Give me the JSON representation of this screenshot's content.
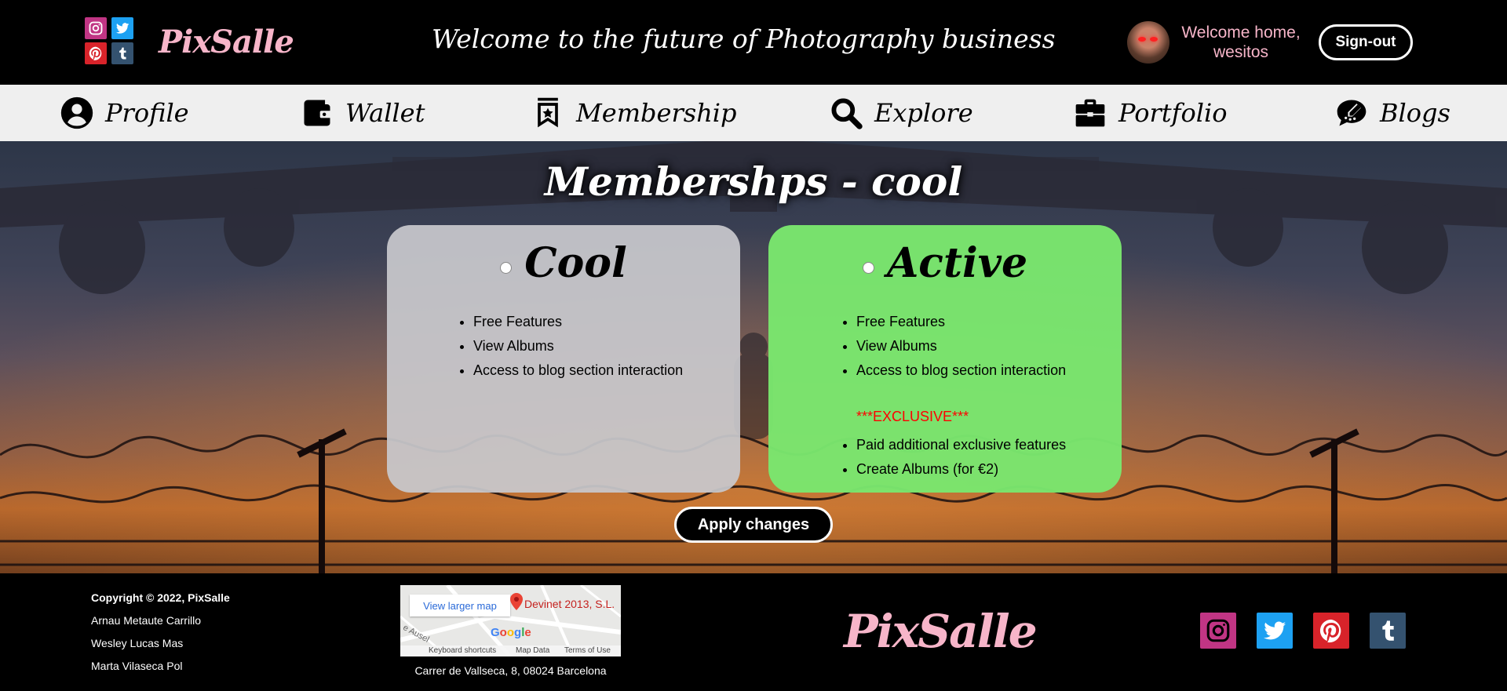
{
  "header": {
    "logo": "PixSalle",
    "tagline": "Welcome to the future of Photography business",
    "welcome": "Welcome home, wesitos",
    "signout_label": "Sign-out",
    "social": [
      "instagram-icon",
      "twitter-icon",
      "pinterest-icon",
      "tumblr-icon"
    ]
  },
  "nav": {
    "items": [
      {
        "label": "Profile",
        "icon": "user-circle-icon"
      },
      {
        "label": "Wallet",
        "icon": "wallet-icon"
      },
      {
        "label": "Membership",
        "icon": "bookmark-star-icon"
      },
      {
        "label": "Explore",
        "icon": "search-icon"
      },
      {
        "label": "Portfolio",
        "icon": "briefcase-icon"
      },
      {
        "label": "Blogs",
        "icon": "comment-pen-icon"
      }
    ]
  },
  "main": {
    "title": "Membershps - cool",
    "plans": [
      {
        "title": "Cool",
        "features": [
          "Free Features",
          "View Albums",
          "Access to blog section interaction"
        ],
        "bg": "#c8c8cc"
      },
      {
        "title": "Active",
        "features": [
          "Free Features",
          "View Albums",
          "Access to blog section interaction"
        ],
        "exclusive_label": "***EXCLUSIVE***",
        "exclusive_features": [
          "Paid additional exclusive features",
          "Create Albums (for €2)"
        ],
        "bg": "#7ae66e"
      }
    ],
    "apply_label": "Apply changes"
  },
  "footer": {
    "copyright": "Copyright © 2022, PixSalle",
    "authors": [
      "Arnau Metaute Carrillo",
      "Wesley Lucas Mas",
      "Marta Vilaseca Pol"
    ],
    "map": {
      "view_larger": "View larger map",
      "place": "Devinet 2013, S.L.",
      "street": "e Ausel",
      "google": "Google",
      "keyboard": "Keyboard shortcuts",
      "map_data": "Map Data",
      "terms": "Terms of Use"
    },
    "address": "Carrer de Vallseca, 8, 08024 Barcelona",
    "logo": "PixSalle"
  },
  "colors": {
    "accent_pink": "#f7b5c9",
    "instagram": "#c13584",
    "twitter": "#1da1f2",
    "pinterest": "#d8232a",
    "tumblr": "#34526f",
    "exclusive_red": "#ff0000"
  }
}
